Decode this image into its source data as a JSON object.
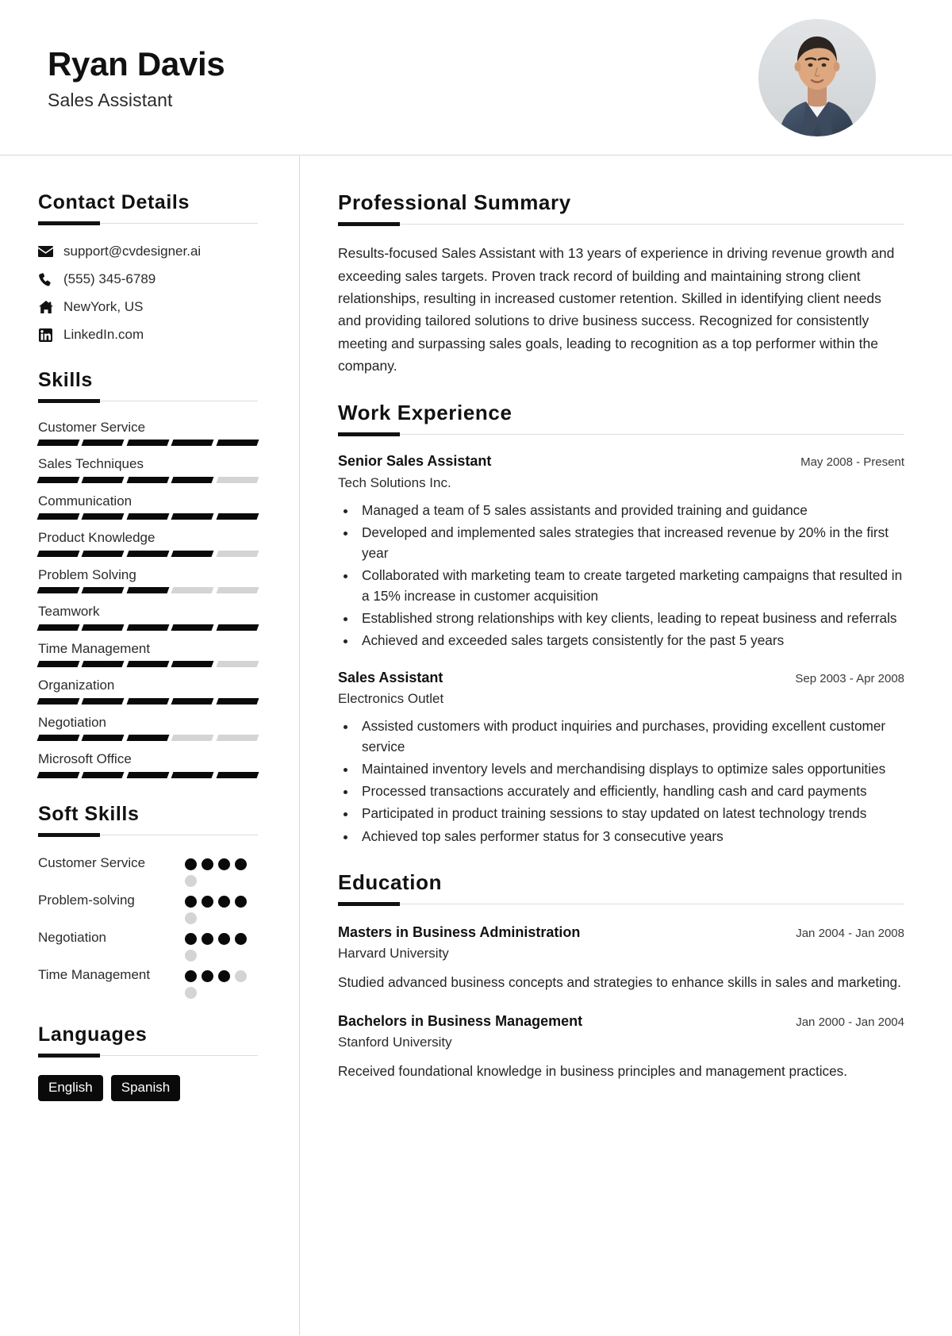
{
  "header": {
    "full_name": "Ryan Davis",
    "job_title": "Sales Assistant",
    "avatar_icon": "profile-photo"
  },
  "sidebar": {
    "contact": {
      "heading": "Contact Details",
      "items": [
        {
          "icon": "envelope-icon",
          "value": "support@cvdesigner.ai"
        },
        {
          "icon": "phone-icon",
          "value": "(555) 345-6789"
        },
        {
          "icon": "home-icon",
          "value": "NewYork, US"
        },
        {
          "icon": "linkedin-icon",
          "value": "LinkedIn.com"
        }
      ]
    },
    "skills": {
      "heading": "Skills",
      "max": 5,
      "items": [
        {
          "label": "Customer Service",
          "level": 5
        },
        {
          "label": "Sales Techniques",
          "level": 4
        },
        {
          "label": "Communication",
          "level": 5
        },
        {
          "label": "Product Knowledge",
          "level": 4
        },
        {
          "label": "Problem Solving",
          "level": 3
        },
        {
          "label": "Teamwork",
          "level": 5
        },
        {
          "label": "Time Management",
          "level": 4
        },
        {
          "label": "Organization",
          "level": 5
        },
        {
          "label": "Negotiation",
          "level": 3
        },
        {
          "label": "Microsoft Office",
          "level": 5
        }
      ]
    },
    "soft_skills": {
      "heading": "Soft Skills",
      "max": 5,
      "items": [
        {
          "label": "Customer Service",
          "level": 4
        },
        {
          "label": "Problem-solving",
          "level": 4
        },
        {
          "label": "Negotiation",
          "level": 4
        },
        {
          "label": "Time Management",
          "level": 3
        }
      ]
    },
    "languages": {
      "heading": "Languages",
      "items": [
        "English",
        "Spanish"
      ]
    }
  },
  "main": {
    "summary": {
      "heading": "Professional Summary",
      "text": "Results-focused Sales Assistant with 13 years of experience in driving revenue growth and exceeding sales targets. Proven track record of building and maintaining strong client relationships, resulting in increased customer retention. Skilled in identifying client needs and providing tailored solutions to drive business success. Recognized for consistently meeting and surpassing sales goals, leading to recognition as a top performer within the company."
    },
    "work": {
      "heading": "Work Experience",
      "entries": [
        {
          "role": "Senior Sales Assistant",
          "company": "Tech Solutions Inc.",
          "date": "May 2008 - Present",
          "bullets": [
            "Managed a team of 5 sales assistants and provided training and guidance",
            "Developed and implemented sales strategies that increased revenue by 20% in the first year",
            "Collaborated with marketing team to create targeted marketing campaigns that resulted in a 15% increase in customer acquisition",
            "Established strong relationships with key clients, leading to repeat business and referrals",
            "Achieved and exceeded sales targets consistently for the past 5 years"
          ]
        },
        {
          "role": "Sales Assistant",
          "company": "Electronics Outlet",
          "date": "Sep 2003 - Apr 2008",
          "bullets": [
            "Assisted customers with product inquiries and purchases, providing excellent customer service",
            "Maintained inventory levels and merchandising displays to optimize sales opportunities",
            "Processed transactions accurately and efficiently, handling cash and card payments",
            "Participated in product training sessions to stay updated on latest technology trends",
            "Achieved top sales performer status for 3 consecutive years"
          ]
        }
      ]
    },
    "education": {
      "heading": "Education",
      "entries": [
        {
          "degree": "Masters in Business Administration",
          "school": "Harvard University",
          "date": "Jan 2004 - Jan 2008",
          "description": "Studied advanced business concepts and strategies to enhance skills in sales and marketing."
        },
        {
          "degree": "Bachelors in Business Management",
          "school": "Stanford University",
          "date": "Jan 2000 - Jan 2004",
          "description": "Received foundational knowledge in business principles and management practices."
        }
      ]
    }
  },
  "colors": {
    "accent": "#0a0a0a",
    "muted_bar": "#d4d4d4",
    "rule": "#dcdcdc",
    "text": "#242424"
  }
}
